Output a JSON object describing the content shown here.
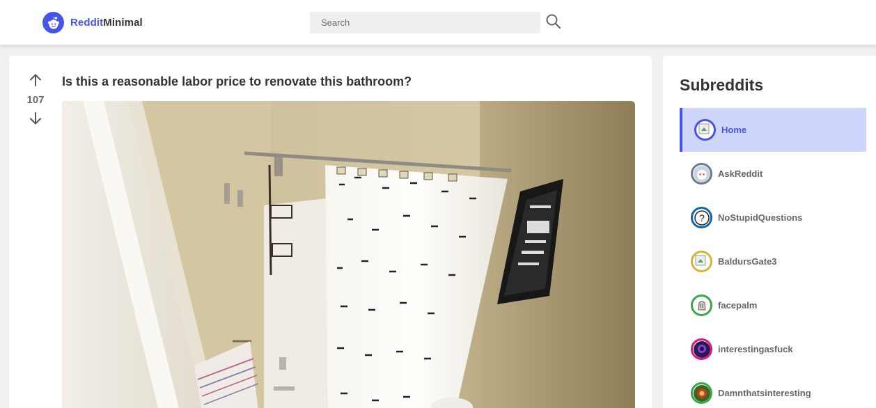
{
  "header": {
    "logo_part1": "Reddit",
    "logo_part2": "Minimal",
    "search_placeholder": "Search"
  },
  "post": {
    "title": "Is this a reasonable labor price to renovate this bathroom?",
    "votes": "107",
    "image_alt": "Bathroom with white tub, shower curtain with black dashes, towel bar and framed wall sign"
  },
  "sidebar": {
    "title": "Subreddits",
    "items": [
      {
        "label": "Home",
        "active": true,
        "ring": "#4655e8"
      },
      {
        "label": "AskReddit",
        "active": false,
        "ring": "#6d7b8c"
      },
      {
        "label": "NoStupidQuestions",
        "active": false,
        "ring": "#0a6ab0"
      },
      {
        "label": "BaldursGate3",
        "active": false,
        "ring": "#d7b436"
      },
      {
        "label": "facepalm",
        "active": false,
        "ring": "#3aa54a"
      },
      {
        "label": "interestingasfuck",
        "active": false,
        "ring": "#e0138c"
      },
      {
        "label": "Damnthatsinteresting",
        "active": false,
        "ring": "#3aa54a"
      }
    ]
  },
  "colors": {
    "accent": "#4655e8",
    "active_bg": "#cfd5fb",
    "page_bg": "#f0f0f0"
  }
}
